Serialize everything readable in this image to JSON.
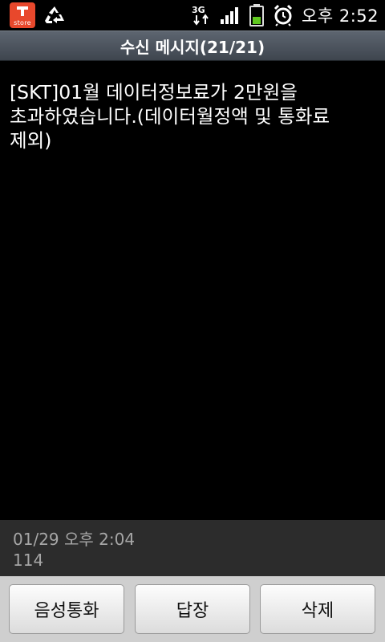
{
  "status_bar": {
    "app_icon_label": "store",
    "icons": [
      "tstore-icon",
      "recycle-icon",
      "3g-data-icon",
      "signal-icon",
      "battery-icon",
      "alarm-icon"
    ],
    "network": "3G",
    "time": "오후 2:52"
  },
  "title_bar": {
    "title": "수신 메시지(21/21)"
  },
  "message": {
    "body": "[SKT]01월 데이터정보료가 2만원을\n초과하였습니다.(데이터월정액 및 통화료\n제외)"
  },
  "info": {
    "date": "01/29 오후 2:04",
    "sender": "114"
  },
  "buttons": {
    "voice_call": "음성통화",
    "reply": "답장",
    "delete": "삭제"
  },
  "colors": {
    "tstore": "#e8482c",
    "battery": "#5fc71f",
    "title_bar": "#4c535c"
  }
}
